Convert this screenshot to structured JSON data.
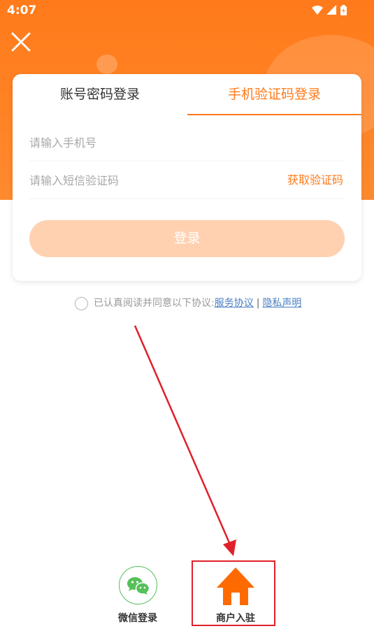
{
  "status_bar": {
    "time": "4:07"
  },
  "tabs": [
    {
      "label": "账号密码登录",
      "active": false
    },
    {
      "label": "手机验证码登录",
      "active": true
    }
  ],
  "form": {
    "phone_placeholder": "请输入手机号",
    "code_placeholder": "请输入短信验证码",
    "get_code_label": "获取验证码",
    "login_label": "登录"
  },
  "agreement": {
    "text": "已认真阅读并同意以下协议:",
    "service_link": "服务协议",
    "separator": "|",
    "privacy_link": "隐私声明"
  },
  "bottom": {
    "wechat_label": "微信登录",
    "merchant_label": "商户入驻"
  },
  "colors": {
    "accent": "#ff7a1a",
    "login_disabled": "#ffd1b1",
    "link": "#4a7fc4",
    "wechat_green": "#56c05a",
    "annotation_red": "#e0202a"
  },
  "icons": [
    "wifi-icon",
    "signal-icon",
    "battery-icon",
    "close-icon",
    "wechat-icon",
    "house-icon",
    "radio-icon"
  ]
}
